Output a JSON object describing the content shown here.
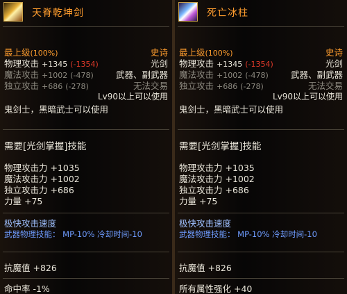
{
  "items": [
    {
      "name": "天脊乾坤剑",
      "grade": "最上级",
      "grade_pct": "(100%)",
      "rarity": "史诗",
      "type": "光剑",
      "phys_atk_label": "物理攻击",
      "phys_atk_value": "+1345",
      "phys_atk_diff": "(-1354)",
      "mag_atk_label": "魔法攻击",
      "mag_atk_value": "+1002",
      "mag_atk_diff": "(-478)",
      "slot": "武器、副武器",
      "ind_atk_label": "独立攻击",
      "ind_atk_value": "+686",
      "ind_atk_diff": "(-278)",
      "trade": "无法交易",
      "level_req": "Lv90以上可以使用",
      "class_req": "鬼剑士，黑暗武士可以使用",
      "skill_req": "需要[光剑掌握]技能",
      "stat1": "物理攻击力 +1035",
      "stat2": "魔法攻击力 +1002",
      "stat3": "独立攻击力 +686",
      "stat4": "力量 +75",
      "speed": "极快攻击速度",
      "weapon_skill": "武器物理技能： MP-10% 冷却时间-10",
      "resist": "抗魔值 +826",
      "bottom": "命中率 -1%"
    },
    {
      "name": "死亡冰柱",
      "grade": "最上级",
      "grade_pct": "(100%)",
      "rarity": "史诗",
      "type": "光剑",
      "phys_atk_label": "物理攻击",
      "phys_atk_value": "+1345",
      "phys_atk_diff": "(-1354)",
      "mag_atk_label": "魔法攻击",
      "mag_atk_value": "+1002",
      "mag_atk_diff": "(-478)",
      "slot": "武器、副武器",
      "ind_atk_label": "独立攻击",
      "ind_atk_value": "+686",
      "ind_atk_diff": "(-278)",
      "trade": "无法交易",
      "level_req": "Lv90以上可以使用",
      "class_req": "鬼剑士，黑暗武士可以使用",
      "skill_req": "需要[光剑掌握]技能",
      "stat1": "物理攻击力 +1035",
      "stat2": "魔法攻击力 +1002",
      "stat3": "独立攻击力 +686",
      "stat4": "力量 +75",
      "speed": "极快攻击速度",
      "weapon_skill": "武器物理技能： MP-10% 冷却时间-10",
      "resist": "抗魔值 +826",
      "bottom": "所有属性强化 +40"
    }
  ],
  "colors": {
    "name": "#ff9d2e",
    "rarity": "#ff9d2e",
    "red": "#e03a2a",
    "blue": "#6f9cff",
    "grey": "#8d8a80"
  },
  "icons": [
    "sword-icon-gold",
    "sword-icon-ice"
  ]
}
